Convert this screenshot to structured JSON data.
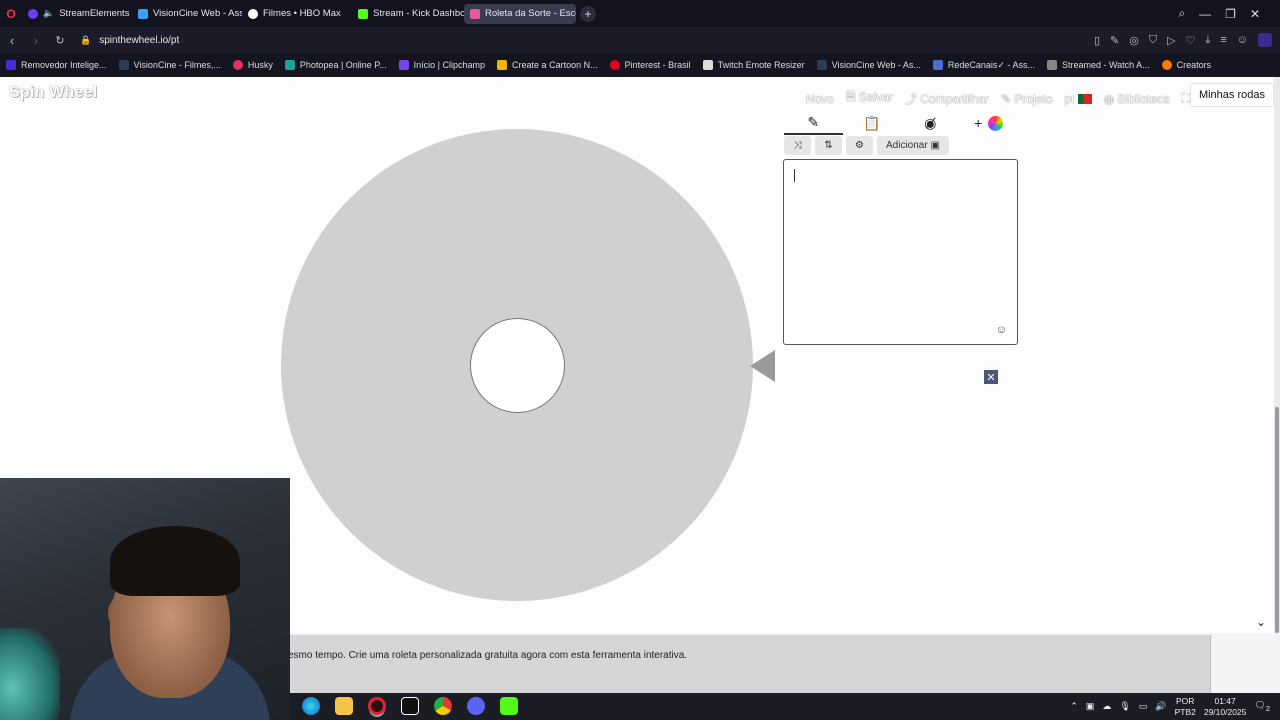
{
  "browser": {
    "tabs": [
      {
        "label": "StreamElements - Son",
        "color": "#6c3cff"
      },
      {
        "label": "VisionCine Web - Assistir",
        "color": "#3aa0ff"
      },
      {
        "label": "Filmes • HBO Max",
        "color": "#ffffff"
      },
      {
        "label": "Stream - Kick Dashboard",
        "color": "#53fc18"
      },
      {
        "label": "Roleta da Sorte - Escolha",
        "color": "#e85a9b"
      }
    ],
    "url": "spinthewheel.io/pt",
    "bookmarks": [
      {
        "label": "Removedor Intelige...",
        "color": "#4b2bd6"
      },
      {
        "label": "VisionCine - Filmes,...",
        "color": "#2a3b52"
      },
      {
        "label": "Husky",
        "color": "#e0306a"
      },
      {
        "label": "Photopea | Online P...",
        "color": "#18a497"
      },
      {
        "label": "Início | Clipchamp",
        "color": "#7a45e6"
      },
      {
        "label": "Create a Cartoon N...",
        "color": "#f2b400"
      },
      {
        "label": "Pinterest - Brasil",
        "color": "#e60023"
      },
      {
        "label": "Twitch Emote Resizer",
        "color": "#dddddd"
      },
      {
        "label": "VisionCine Web - As...",
        "color": "#2a3b52"
      },
      {
        "label": "RedeCanais✓ - Ass...",
        "color": "#4a6cd4"
      },
      {
        "label": "Streamed - Watch A...",
        "color": "#888888"
      },
      {
        "label": "Creators",
        "color": "#ff7a00"
      }
    ]
  },
  "app": {
    "logo": "Spin Wheel",
    "nav": {
      "novo": "Novo",
      "salvar": "Salvar",
      "compartilhar": "Compartilhar",
      "projeto": "Projeto",
      "lang": "pt",
      "biblioteca": "Biblioteca"
    },
    "minhas_rodas": "Minhas rodas",
    "add_button": "Adicionar",
    "plus": "+",
    "footer_text": "esmo tempo. Crie uma roleta personalizada gratuita agora com esta ferramenta interativa.",
    "wheel_color": "#d0d0d0"
  },
  "taskbar": {
    "lang_top": "POR",
    "lang_bottom": "PTB2",
    "time": "01:47",
    "date": "29/10/2025",
    "notifications": "2"
  }
}
